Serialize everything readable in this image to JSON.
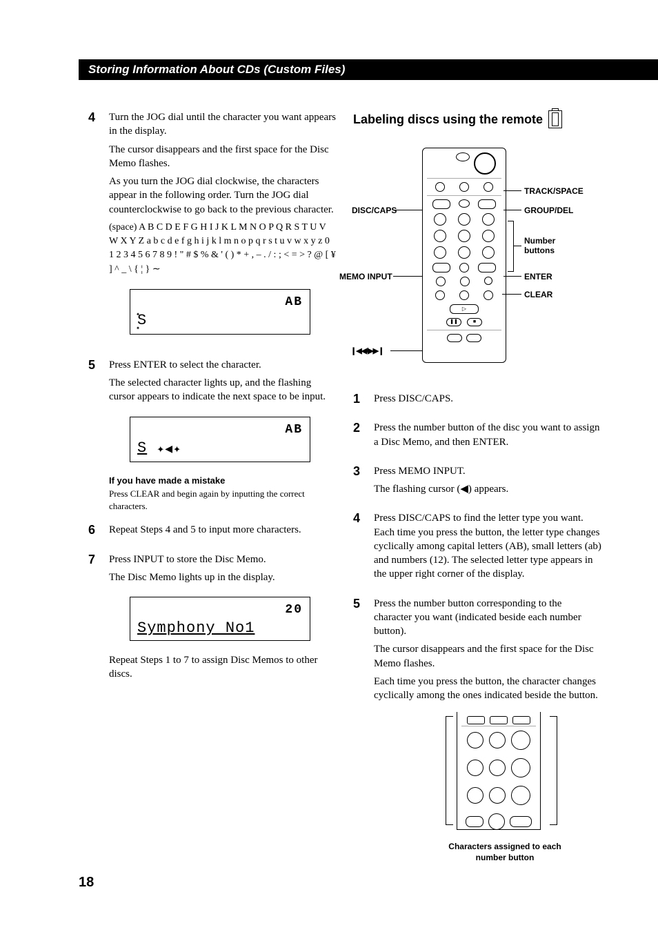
{
  "header": "Storing Information About CDs (Custom Files)",
  "page_number": "18",
  "left": {
    "step4": {
      "num": "4",
      "p1": "Turn the JOG dial until the character you want appears in the display.",
      "p2": "The cursor disappears and the first space for the Disc Memo flashes.",
      "p3": "As you turn the JOG dial clockwise, the characters appear in the following order. Turn the JOG dial counterclockwise to go back to the previous character.",
      "chars": "(space) A B C D E F G H I J K L M N O P Q R S T U V W X Y Z a b c d e f g h i j k l m n o p q r s t u v w x y z 0 1 2 3 4 5 6 7 8 9 ! \" # $ % & ' ( ) * + , – . / : ; < = > ? @ [ ¥ ] ^ _ \\ { ¦ } ∼",
      "lcd_tr": "AB",
      "lcd_main": "S"
    },
    "step5": {
      "num": "5",
      "p1": "Press ENTER to select the character.",
      "p2": "The selected character lights up, and the flashing cursor appears to indicate the next space to be input.",
      "lcd_tr": "AB",
      "lcd_main_pre": "S ",
      "mistake_head": "If you have made a mistake",
      "mistake_body": "Press CLEAR and begin again by inputting the correct characters."
    },
    "step6": {
      "num": "6",
      "p1": "Repeat Steps 4 and 5 to input more characters."
    },
    "step7": {
      "num": "7",
      "p1": "Press INPUT to store the Disc Memo.",
      "p2": "The Disc Memo lights up in the display.",
      "lcd_tr": "20",
      "lcd_main": "Symphony No1",
      "p3": "Repeat Steps 1 to 7 to assign Disc Memos to other discs."
    }
  },
  "right": {
    "title": "Labeling discs using the remote",
    "labels": {
      "disc_caps": "DISC/CAPS",
      "memo_input": "MEMO INPUT",
      "prev_next": "./>",
      "track_space": "TRACK/SPACE",
      "group_del": "GROUP/DEL",
      "number_buttons": "Number buttons",
      "enter": "ENTER",
      "clear": "CLEAR"
    },
    "step1": {
      "num": "1",
      "p1": "Press DISC/CAPS."
    },
    "step2": {
      "num": "2",
      "p1": "Press the number button of the disc you want to assign a Disc Memo, and then ENTER."
    },
    "step3": {
      "num": "3",
      "p1": "Press MEMO INPUT.",
      "p2": "The flashing cursor (0) appears."
    },
    "step4": {
      "num": "4",
      "p1": "Press DISC/CAPS to find the letter type you want. Each time you press the button, the letter type changes cyclically among capital letters (AB), small letters (ab) and numbers (12). The selected letter type appears in the upper right corner of the display."
    },
    "step5": {
      "num": "5",
      "p1": "Press the number button corresponding to the character you want (indicated beside each number button).",
      "p2": "The cursor disappears and the first space for the Disc Memo flashes.",
      "p3": "Each time you press the button, the character changes cyclically among the ones indicated beside the button."
    },
    "caption": "Characters assigned to each number button"
  }
}
